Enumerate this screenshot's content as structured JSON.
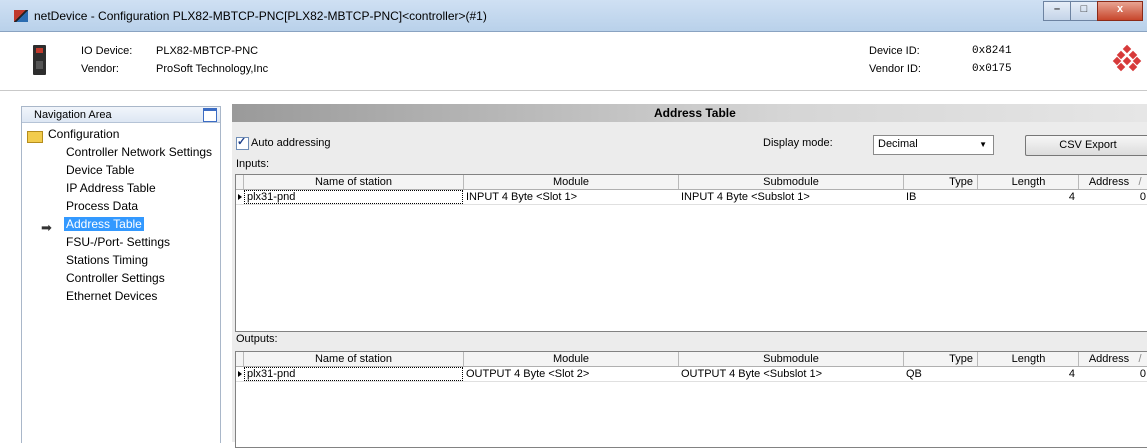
{
  "window": {
    "title": "netDevice - Configuration PLX82-MBTCP-PNC[PLX82-MBTCP-PNC]<controller>(#1)",
    "buttons": {
      "minimize": "–",
      "maximize": "□",
      "close": "x"
    }
  },
  "device": {
    "io_device_label": "IO Device:",
    "io_device_value": "PLX82-MBTCP-PNC",
    "vendor_label": "Vendor:",
    "vendor_value": "ProSoft Technology,Inc",
    "device_id_label": "Device ID:",
    "device_id_value": "0x8241",
    "vendor_id_label": "Vendor ID:",
    "vendor_id_value": "0x0175"
  },
  "nav": {
    "title": "Navigation Area",
    "root": "Configuration",
    "items": [
      {
        "label": "Controller Network Settings"
      },
      {
        "label": "Device Table"
      },
      {
        "label": "IP Address Table"
      },
      {
        "label": "Process Data"
      },
      {
        "label": "Address Table",
        "selected": true
      },
      {
        "label": "FSU-/Port- Settings"
      },
      {
        "label": "Stations Timing"
      },
      {
        "label": "Controller Settings"
      },
      {
        "label": "Ethernet Devices"
      }
    ]
  },
  "main": {
    "title": "Address Table",
    "auto_addressing": {
      "label": "Auto addressing",
      "checked": true
    },
    "display_mode_label": "Display mode:",
    "display_mode_value": "Decimal",
    "csv_export": "CSV Export",
    "inputs_label": "Inputs:",
    "outputs_label": "Outputs:",
    "columns": [
      "Name of station",
      "Module",
      "Submodule",
      "Type",
      "Length",
      "Address",
      "/"
    ],
    "inputs_rows": [
      {
        "station": "plx31-pnd",
        "module": "INPUT 4 Byte <Slot 1>",
        "submodule": "INPUT 4 Byte <Subslot 1>",
        "type": "IB",
        "length": "4",
        "address": "0"
      }
    ],
    "outputs_rows": [
      {
        "station": "plx31-pnd",
        "module": "OUTPUT 4 Byte <Slot 2>",
        "submodule": "OUTPUT 4 Byte <Subslot 1>",
        "type": "QB",
        "length": "4",
        "address": "0"
      }
    ]
  }
}
